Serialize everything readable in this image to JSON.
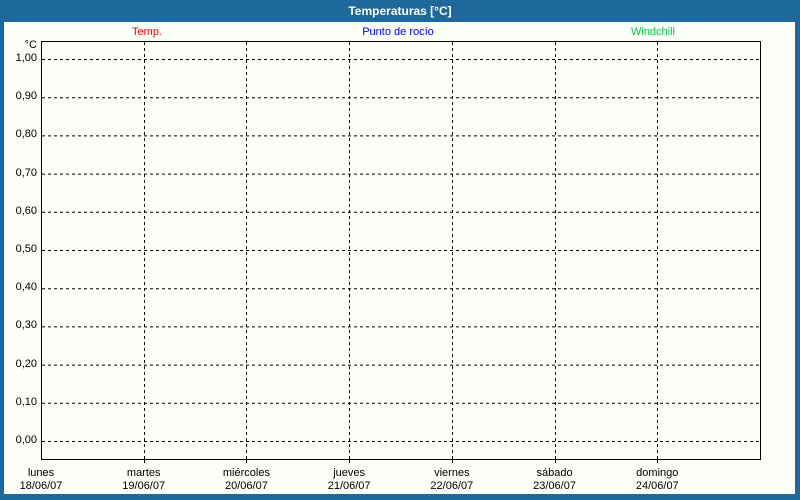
{
  "window": {
    "title": "Temperaturas [°C]"
  },
  "legend": [
    {
      "label": "Temp.",
      "color": "#ff0000"
    },
    {
      "label": "Punto de rocío",
      "color": "#0000ff"
    },
    {
      "label": "Windchill",
      "color": "#00cc44"
    }
  ],
  "chart_data": {
    "type": "line",
    "title": "Temperaturas [°C]",
    "ylabel": "°C",
    "ylim": [
      0.0,
      1.0
    ],
    "ytick_step": 0.1,
    "ytick_labels": [
      "1,00",
      "0,90",
      "0,80",
      "0,70",
      "0,60",
      "0,50",
      "0,40",
      "0,30",
      "0,20",
      "0,10",
      "0,00"
    ],
    "x_days": [
      {
        "weekday": "lunes",
        "date": "18/06/07"
      },
      {
        "weekday": "martes",
        "date": "19/06/07"
      },
      {
        "weekday": "miércoles",
        "date": "20/06/07"
      },
      {
        "weekday": "jueves",
        "date": "21/06/07"
      },
      {
        "weekday": "viernes",
        "date": "22/06/07"
      },
      {
        "weekday": "sábado",
        "date": "23/06/07"
      },
      {
        "weekday": "domingo",
        "date": "24/06/07"
      }
    ],
    "series": [
      {
        "name": "Temp.",
        "color": "#ff0000",
        "values": []
      },
      {
        "name": "Punto de rocío",
        "color": "#0000ff",
        "values": []
      },
      {
        "name": "Windchill",
        "color": "#00cc44",
        "values": []
      }
    ],
    "grid": "dashed",
    "legend_position": "top"
  }
}
